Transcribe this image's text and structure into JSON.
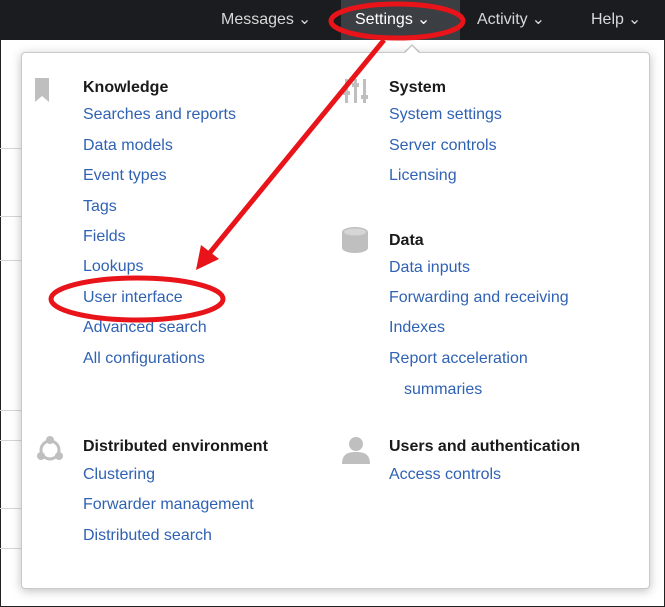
{
  "topnav": {
    "messages": "Messages",
    "settings": "Settings",
    "activity": "Activity",
    "help": "Help"
  },
  "menu": {
    "knowledge": {
      "title": "Knowledge",
      "links": [
        "Searches and reports",
        "Data models",
        "Event types",
        "Tags",
        "Fields",
        "Lookups",
        "User interface",
        "Advanced search",
        "All configurations"
      ]
    },
    "system": {
      "title": "System",
      "links": [
        "System settings",
        "Server controls",
        "Licensing"
      ]
    },
    "data": {
      "title": "Data",
      "links": [
        "Data inputs",
        "Forwarding and receiving",
        "Indexes",
        "Report acceleration",
        "summaries"
      ]
    },
    "distributed": {
      "title": "Distributed environment",
      "links": [
        "Clustering",
        "Forwarder management",
        "Distributed search"
      ]
    },
    "users": {
      "title": "Users and authentication",
      "links": [
        "Access controls"
      ]
    }
  },
  "annotation_color": "#e8141a",
  "link_color": "#2f62b3",
  "icons": {
    "knowledge": "bookmark-icon",
    "system": "sliders-icon",
    "data": "database-icon",
    "distributed": "network-icon",
    "users": "user-icon"
  }
}
